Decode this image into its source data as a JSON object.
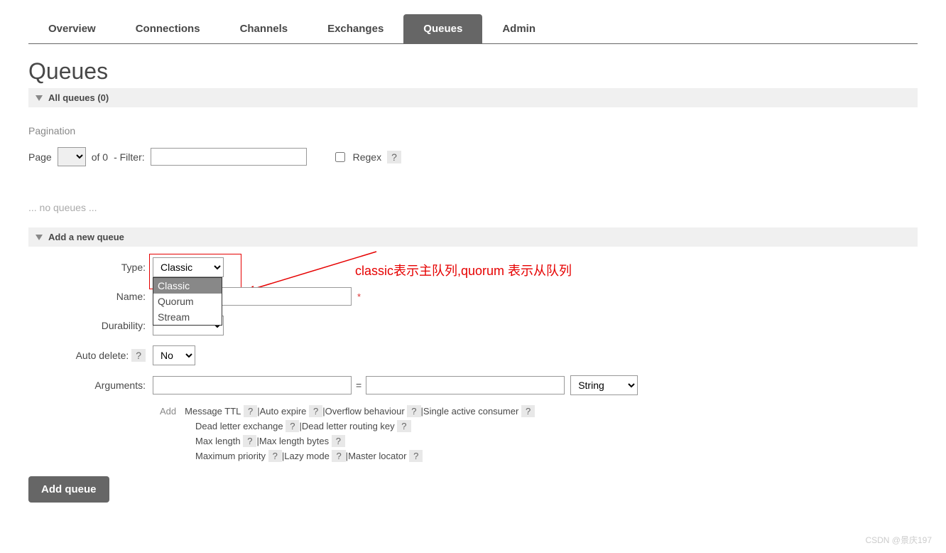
{
  "tabs": {
    "overview": "Overview",
    "connections": "Connections",
    "channels": "Channels",
    "exchanges": "Exchanges",
    "queues": "Queues",
    "admin": "Admin"
  },
  "page_title": "Queues",
  "sections": {
    "all_queues": "All queues (0)",
    "add_queue": "Add a new queue"
  },
  "pagination": {
    "label": "Pagination",
    "page_lbl": "Page",
    "of_lbl": "of 0",
    "filter_lbl": "- Filter:",
    "regex_lbl": "Regex",
    "help": "?"
  },
  "noqueues": "... no queues ...",
  "form": {
    "type_label": "Type:",
    "type_value": "Classic",
    "type_options": [
      "Classic",
      "Quorum",
      "Stream"
    ],
    "name_label": "Name:",
    "req": "*",
    "durability_label": "Durability:",
    "autodelete_label": "Auto delete:",
    "autodelete_value": "No",
    "arguments_label": "Arguments:",
    "eq": "=",
    "argtype_value": "String",
    "add_label": "Add",
    "help": "?"
  },
  "arg_links": {
    "row1": [
      "Message TTL",
      "Auto expire",
      "Overflow behaviour",
      "Single active consumer"
    ],
    "row2": [
      "Dead letter exchange",
      "Dead letter routing key"
    ],
    "row3": [
      "Max length",
      "Max length bytes"
    ],
    "row4": [
      "Maximum priority",
      "Lazy mode",
      "Master locator"
    ]
  },
  "submit": "Add queue",
  "annotation": "classic表示主队列,quorum 表示从队列",
  "watermark": "CSDN @景庆197"
}
